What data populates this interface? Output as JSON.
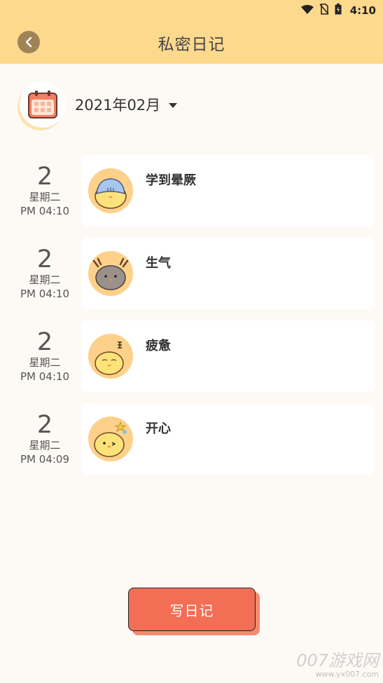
{
  "status_bar": {
    "time": "4:10"
  },
  "header": {
    "title": "私密日记"
  },
  "month": {
    "label": "2021年02月"
  },
  "entries": [
    {
      "day": "2",
      "weekday": "星期二",
      "time": "PM 04:10",
      "mood": "学到晕厥",
      "avatar": "blue-hat-chick"
    },
    {
      "day": "2",
      "weekday": "星期二",
      "time": "PM 04:10",
      "mood": "生气",
      "avatar": "angry-gray-chick"
    },
    {
      "day": "2",
      "weekday": "星期二",
      "time": "PM 04:10",
      "mood": "疲惫",
      "avatar": "tired-chick"
    },
    {
      "day": "2",
      "weekday": "星期二",
      "time": "PM 04:09",
      "mood": "开心",
      "avatar": "happy-chick"
    }
  ],
  "write_button": {
    "label": "写日记"
  },
  "watermark": {
    "main": "007游戏网",
    "sub": "www.yx007.com"
  },
  "colors": {
    "header_bg": "#fdd98e",
    "accent": "#f26e55",
    "page_bg": "#fdfaf5"
  }
}
